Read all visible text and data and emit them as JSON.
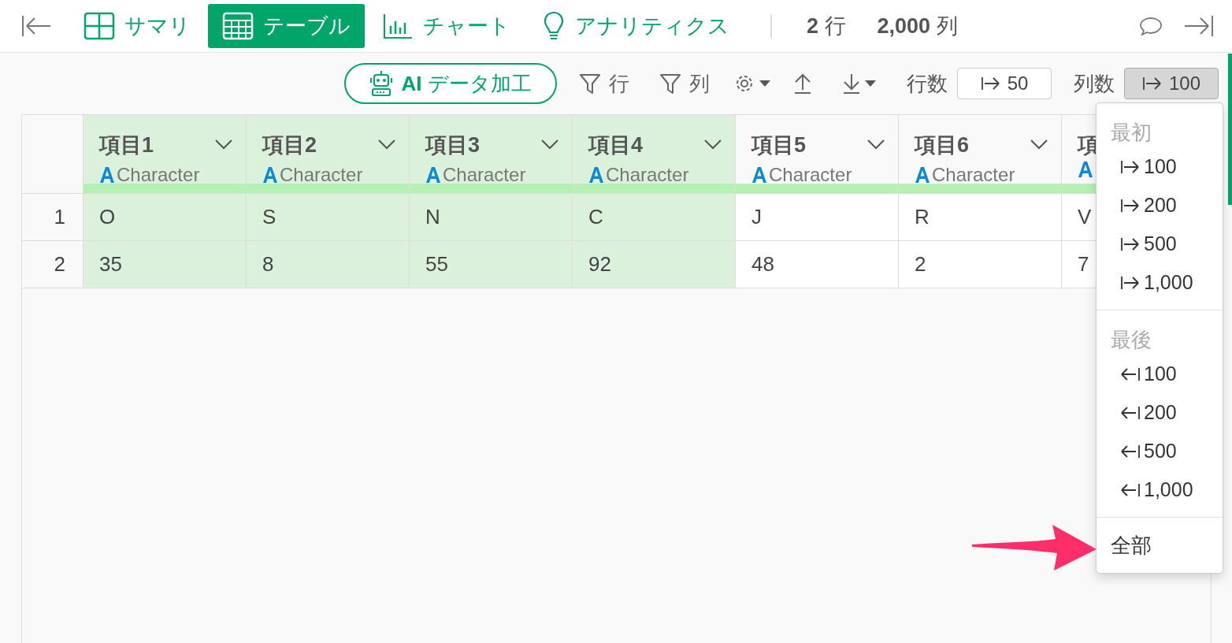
{
  "nav": {
    "tabs": [
      {
        "label": "サマリ",
        "selected": false
      },
      {
        "label": "テーブル",
        "selected": true
      },
      {
        "label": "チャート",
        "selected": false
      },
      {
        "label": "アナリティクス",
        "selected": false
      }
    ],
    "stats": [
      {
        "value": "2",
        "unit": "行"
      },
      {
        "value": "2,000",
        "unit": "列"
      }
    ]
  },
  "toolbar": {
    "ai_button": {
      "prefix": "AI",
      "label": "データ加工"
    },
    "row_filter": "行",
    "column_filter": "列",
    "row_count": {
      "label": "行数",
      "value": "50",
      "pressed": false
    },
    "column_count": {
      "label": "列数",
      "value": "100",
      "pressed": true
    }
  },
  "table": {
    "columns": [
      {
        "name": "項目1",
        "type": "Character",
        "selected": true
      },
      {
        "name": "項目2",
        "type": "Character",
        "selected": true
      },
      {
        "name": "項目3",
        "type": "Character",
        "selected": true
      },
      {
        "name": "項目4",
        "type": "Character",
        "selected": true
      },
      {
        "name": "項目5",
        "type": "Character",
        "selected": false
      },
      {
        "name": "項目6",
        "type": "Character",
        "selected": false
      },
      {
        "name": "項",
        "selected": false
      }
    ],
    "rows": [
      {
        "number": "1",
        "cells": [
          "O",
          "S",
          "N",
          "C",
          "J",
          "R",
          "V"
        ]
      },
      {
        "number": "2",
        "cells": [
          "35",
          "8",
          "55",
          "92",
          "48",
          "2",
          "7"
        ]
      }
    ]
  },
  "menu": {
    "sections": [
      {
        "heading": "最初",
        "items": [
          {
            "label": "100",
            "kind": "first"
          },
          {
            "label": "200",
            "kind": "first"
          },
          {
            "label": "500",
            "kind": "first"
          },
          {
            "label": "1,000",
            "kind": "first"
          }
        ]
      },
      {
        "heading": "最後",
        "items": [
          {
            "label": "100",
            "kind": "last"
          },
          {
            "label": "200",
            "kind": "last"
          },
          {
            "label": "500",
            "kind": "last"
          },
          {
            "label": "1,000",
            "kind": "last"
          }
        ]
      }
    ],
    "all": "全部"
  }
}
